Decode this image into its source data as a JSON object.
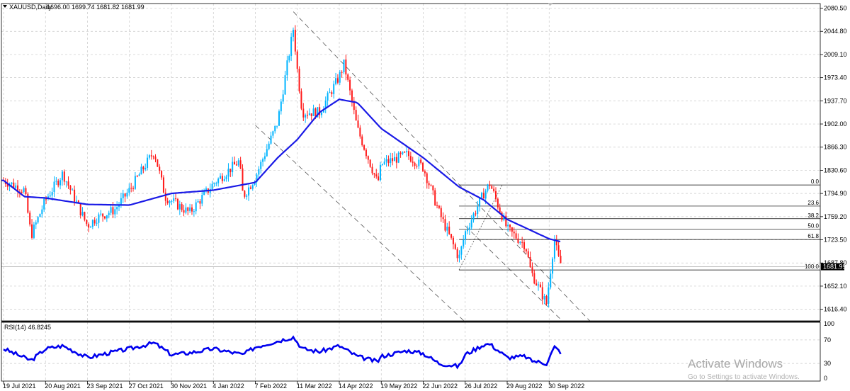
{
  "header": {
    "symbol": "XAUUSD,Daily",
    "ohlc": "1696.00 1699.74 1681.82 1681.99"
  },
  "price_axis": {
    "ticks": [
      "2080.50",
      "2044.80",
      "2009.10",
      "1973.40",
      "1937.70",
      "1902.00",
      "1866.30",
      "1830.60",
      "1794.90",
      "1759.20",
      "1723.50",
      "1687.80",
      "1652.10",
      "1616.40"
    ],
    "current_price": "1681.99"
  },
  "rsi": {
    "label": "RSI(14) 46.8245",
    "ticks": [
      "100",
      "70",
      "30",
      "0"
    ],
    "levels": [
      30,
      70
    ]
  },
  "time_axis": [
    "19 Jul 2021",
    "20 Aug 2021",
    "23 Sep 2021",
    "27 Oct 2021",
    "30 Nov 2021",
    "4 Jan 2022",
    "7 Feb 2022",
    "11 Mar 2022",
    "14 Apr 2022",
    "19 May 2022",
    "22 Jun 2022",
    "26 Jul 2022",
    "29 Aug 2022",
    "30 Sep 2022"
  ],
  "fibonacci": {
    "levels": [
      {
        "label": "0.0",
        "price": 1808.0
      },
      {
        "label": "23.6",
        "price": 1775.5
      },
      {
        "label": "38.2",
        "price": 1756.0
      },
      {
        "label": "50.0",
        "price": 1740.0
      },
      {
        "label": "61.8",
        "price": 1724.0
      },
      {
        "label": "100.0",
        "price": 1677.0
      }
    ]
  },
  "watermark": {
    "line1": "Activate Windows",
    "line2": "Go to Settings to activate Windows."
  },
  "colors": {
    "up": "#00b4ff",
    "down": "#ff1a1a",
    "ma": "#1a1ae6",
    "rsi": "#0000ee",
    "grid": "#c8c8c8"
  },
  "chart_data": {
    "type": "candlestick",
    "title": "XAUUSD,Daily",
    "xlabel": "",
    "ylabel": "",
    "ylim": [
      1598.55,
      2087.64
    ],
    "grid": true,
    "overlays": [
      "moving average",
      "descending trend channel",
      "fibonacci retracement"
    ],
    "close_anchors": [
      {
        "date": "19 Jul 2021",
        "close": 1815
      },
      {
        "date": "4 Aug 2021",
        "close": 1800
      },
      {
        "date": "9 Aug 2021",
        "close": 1730
      },
      {
        "date": "20 Aug 2021",
        "close": 1785
      },
      {
        "date": "3 Sep 2021",
        "close": 1826
      },
      {
        "date": "23 Sep 2021",
        "close": 1745
      },
      {
        "date": "30 Sep 2021",
        "close": 1757
      },
      {
        "date": "15 Oct 2021",
        "close": 1770
      },
      {
        "date": "27 Oct 2021",
        "close": 1800
      },
      {
        "date": "16 Nov 2021",
        "close": 1860
      },
      {
        "date": "25 Nov 2021",
        "close": 1790
      },
      {
        "date": "15 Dec 2021",
        "close": 1765
      },
      {
        "date": "4 Jan 2022",
        "close": 1810
      },
      {
        "date": "25 Jan 2022",
        "close": 1845
      },
      {
        "date": "28 Jan 2022",
        "close": 1790
      },
      {
        "date": "7 Feb 2022",
        "close": 1820
      },
      {
        "date": "24 Feb 2022",
        "close": 1905
      },
      {
        "date": "8 Mar 2022",
        "close": 2050
      },
      {
        "date": "15 Mar 2022",
        "close": 1920
      },
      {
        "date": "11 Mar 2022",
        "close": 1985
      },
      {
        "date": "29 Mar 2022",
        "close": 1920
      },
      {
        "date": "14 Apr 2022",
        "close": 1975
      },
      {
        "date": "18 Apr 2022",
        "close": 1995
      },
      {
        "date": "29 Apr 2022",
        "close": 1895
      },
      {
        "date": "16 May 2022",
        "close": 1810
      },
      {
        "date": "19 May 2022",
        "close": 1840
      },
      {
        "date": "9 Jun 2022",
        "close": 1855
      },
      {
        "date": "22 Jun 2022",
        "close": 1835
      },
      {
        "date": "5 Jul 2022",
        "close": 1765
      },
      {
        "date": "21 Jul 2022",
        "close": 1695
      },
      {
        "date": "26 Jul 2022",
        "close": 1735
      },
      {
        "date": "10 Aug 2022",
        "close": 1795
      },
      {
        "date": "15 Aug 2022",
        "close": 1810
      },
      {
        "date": "29 Aug 2022",
        "close": 1740
      },
      {
        "date": "12 Sep 2022",
        "close": 1715
      },
      {
        "date": "16 Sep 2022",
        "close": 1675
      },
      {
        "date": "28 Sep 2022",
        "close": 1625
      },
      {
        "date": "30 Sep 2022",
        "close": 1660
      },
      {
        "date": "4 Oct 2022",
        "close": 1725
      },
      {
        "date": "7 Oct 2022",
        "close": 1695
      },
      {
        "date": "10 Oct 2022",
        "close": 1681.99
      }
    ],
    "ma_anchors": [
      {
        "date": "19 Jul 2021",
        "value": 1815
      },
      {
        "date": "4 Aug 2021",
        "value": 1790
      },
      {
        "date": "20 Aug 2021",
        "value": 1788
      },
      {
        "date": "23 Sep 2021",
        "value": 1778
      },
      {
        "date": "27 Oct 2021",
        "value": 1777
      },
      {
        "date": "30 Nov 2021",
        "value": 1795
      },
      {
        "date": "4 Jan 2022",
        "value": 1800
      },
      {
        "date": "7 Feb 2022",
        "value": 1812
      },
      {
        "date": "24 Feb 2022",
        "value": 1850
      },
      {
        "date": "11 Mar 2022",
        "value": 1878
      },
      {
        "date": "29 Mar 2022",
        "value": 1920
      },
      {
        "date": "14 Apr 2022",
        "value": 1940
      },
      {
        "date": "29 Apr 2022",
        "value": 1935
      },
      {
        "date": "19 May 2022",
        "value": 1895
      },
      {
        "date": "22 Jun 2022",
        "value": 1850
      },
      {
        "date": "21 Jul 2022",
        "value": 1805
      },
      {
        "date": "10 Aug 2022",
        "value": 1785
      },
      {
        "date": "29 Aug 2022",
        "value": 1755
      },
      {
        "date": "30 Sep 2022",
        "value": 1725
      },
      {
        "date": "10 Oct 2022",
        "value": 1720
      }
    ],
    "rsi_anchors": [
      {
        "date": "19 Jul 2021",
        "value": 55
      },
      {
        "date": "9 Aug 2021",
        "value": 35
      },
      {
        "date": "20 Aug 2021",
        "value": 55
      },
      {
        "date": "3 Sep 2021",
        "value": 60
      },
      {
        "date": "23 Sep 2021",
        "value": 40
      },
      {
        "date": "15 Oct 2021",
        "value": 50
      },
      {
        "date": "27 Oct 2021",
        "value": 55
      },
      {
        "date": "16 Nov 2021",
        "value": 65
      },
      {
        "date": "30 Nov 2021",
        "value": 45
      },
      {
        "date": "15 Dec 2021",
        "value": 48
      },
      {
        "date": "4 Jan 2022",
        "value": 55
      },
      {
        "date": "28 Jan 2022",
        "value": 45
      },
      {
        "date": "7 Feb 2022",
        "value": 58
      },
      {
        "date": "24 Feb 2022",
        "value": 68
      },
      {
        "date": "8 Mar 2022",
        "value": 75
      },
      {
        "date": "15 Mar 2022",
        "value": 55
      },
      {
        "date": "29 Mar 2022",
        "value": 50
      },
      {
        "date": "14 Apr 2022",
        "value": 60
      },
      {
        "date": "29 Apr 2022",
        "value": 42
      },
      {
        "date": "16 May 2022",
        "value": 33
      },
      {
        "date": "19 May 2022",
        "value": 42
      },
      {
        "date": "9 Jun 2022",
        "value": 52
      },
      {
        "date": "22 Jun 2022",
        "value": 47
      },
      {
        "date": "5 Jul 2022",
        "value": 30
      },
      {
        "date": "21 Jul 2022",
        "value": 25
      },
      {
        "date": "26 Jul 2022",
        "value": 45
      },
      {
        "date": "10 Aug 2022",
        "value": 62
      },
      {
        "date": "15 Aug 2022",
        "value": 63
      },
      {
        "date": "29 Aug 2022",
        "value": 40
      },
      {
        "date": "12 Sep 2022",
        "value": 42
      },
      {
        "date": "16 Sep 2022",
        "value": 35
      },
      {
        "date": "28 Sep 2022",
        "value": 30
      },
      {
        "date": "4 Oct 2022",
        "value": 58
      },
      {
        "date": "10 Oct 2022",
        "value": 46.8
      }
    ]
  }
}
